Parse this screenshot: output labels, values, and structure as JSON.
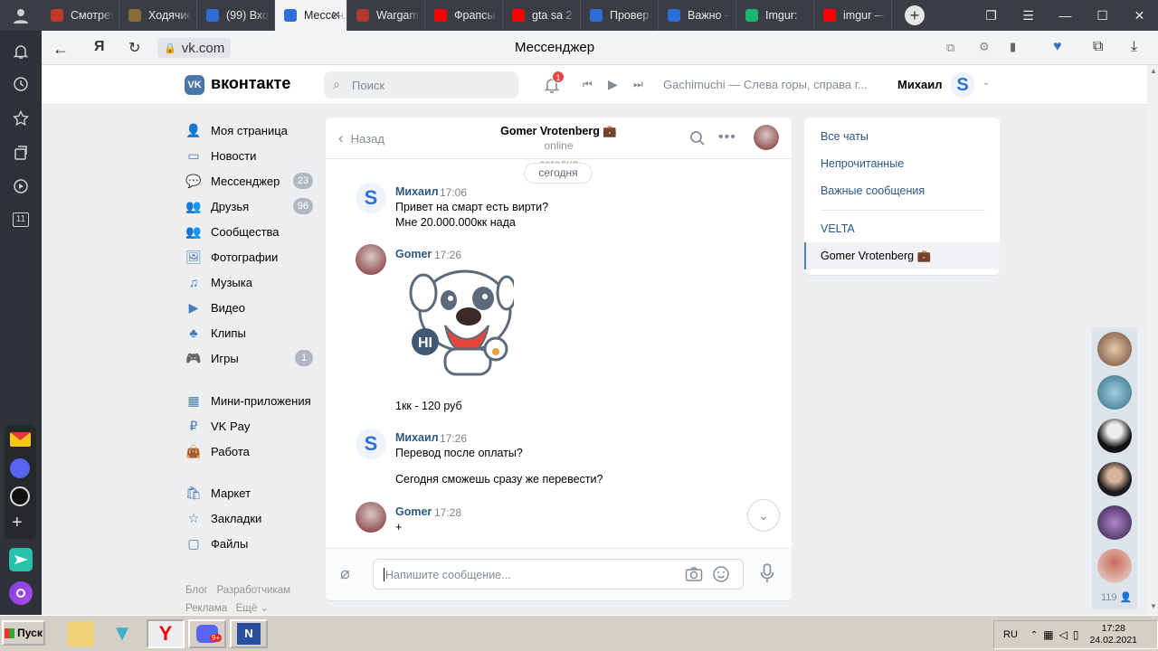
{
  "browser": {
    "tabs": [
      {
        "title": "Смотрет",
        "color": "#c0392b"
      },
      {
        "title": "Ходячие",
        "color": "#8a6d3b"
      },
      {
        "title": "(99) Вхо",
        "color": "#2f6ed6"
      },
      {
        "title": "Мессенджер",
        "color": "#2f6ed6",
        "active": true
      },
      {
        "title": "Wargam",
        "color": "#b03a2e"
      },
      {
        "title": "Фрапсы",
        "color": "#ff0000"
      },
      {
        "title": "gta sa 2",
        "color": "#ff0000"
      },
      {
        "title": "Провер",
        "color": "#2f6ed6"
      },
      {
        "title": "Важно -",
        "color": "#2f6ed6"
      },
      {
        "title": "Imgur: ",
        "color": "#1bb76e"
      },
      {
        "title": "imgur —",
        "color": "#ff0000"
      }
    ],
    "url": "vk.com",
    "page_title": "Мессенджер",
    "rail_badge": "11"
  },
  "vk": {
    "logo": "вконтакте",
    "search_placeholder": "Поиск",
    "notifications_count": "1",
    "player_track": "Gachimuchi — Слева горы, справа г...",
    "user_name": "Михаил",
    "nav": [
      {
        "label": "Моя страница"
      },
      {
        "label": "Новости"
      },
      {
        "label": "Мессенджер",
        "count": "23"
      },
      {
        "label": "Друзья",
        "count": "96"
      },
      {
        "label": "Сообщества"
      },
      {
        "label": "Фотографии"
      },
      {
        "label": "Музыка"
      },
      {
        "label": "Видео"
      },
      {
        "label": "Клипы"
      },
      {
        "label": "Игры",
        "count": "1"
      },
      {
        "label": "Мини-приложения"
      },
      {
        "label": "VK Pay"
      },
      {
        "label": "Работа"
      },
      {
        "label": "Маркет"
      },
      {
        "label": "Закладки"
      },
      {
        "label": "Файлы"
      }
    ],
    "footer_links": [
      "Блог",
      "Разработчикам",
      "Реклама",
      "Ещё"
    ]
  },
  "chat": {
    "back_label": "Назад",
    "peer_name": "Gomer Vrotenberg 💼",
    "peer_status": "online",
    "date_divider_prev": "сегодня",
    "date_divider": "сегодня",
    "messages": [
      {
        "author": "Михаил",
        "time": "17:06",
        "lines": [
          "Привет на смарт есть вирти?",
          "Мне 20.000.000кк нада"
        ]
      },
      {
        "author": "Gomer",
        "time": "17:26",
        "sticker": "HI",
        "lines": [
          "1кк - 120 руб"
        ]
      },
      {
        "author": "Михаил",
        "time": "17:26",
        "lines": [
          "Перевод после оплаты?",
          "Сегодня сможешь сразу же перевести?"
        ]
      },
      {
        "author": "Gomer",
        "time": "17:28",
        "lines": [
          "+"
        ]
      }
    ],
    "input_placeholder": "Напишите сообщение..."
  },
  "right_menu": {
    "items": [
      "Все чаты",
      "Непрочитанные",
      "Важные сообщения"
    ],
    "folders": [
      "VELTA",
      "Gomer Vrotenberg 💼"
    ]
  },
  "friends_count": "119",
  "taskbar": {
    "start": "Пуск",
    "lang": "RU",
    "time": "17:28",
    "date": "24.02.2021",
    "discord_badge": "9+"
  }
}
